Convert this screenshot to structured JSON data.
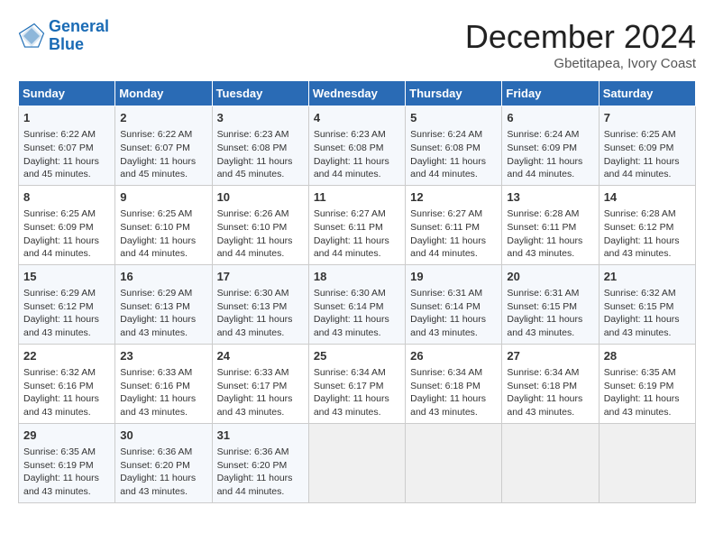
{
  "header": {
    "logo_line1": "General",
    "logo_line2": "Blue",
    "month": "December 2024",
    "location": "Gbetitapea, Ivory Coast"
  },
  "weekdays": [
    "Sunday",
    "Monday",
    "Tuesday",
    "Wednesday",
    "Thursday",
    "Friday",
    "Saturday"
  ],
  "weeks": [
    [
      {
        "day": "1",
        "lines": [
          "Sunrise: 6:22 AM",
          "Sunset: 6:07 PM",
          "Daylight: 11 hours",
          "and 45 minutes."
        ]
      },
      {
        "day": "2",
        "lines": [
          "Sunrise: 6:22 AM",
          "Sunset: 6:07 PM",
          "Daylight: 11 hours",
          "and 45 minutes."
        ]
      },
      {
        "day": "3",
        "lines": [
          "Sunrise: 6:23 AM",
          "Sunset: 6:08 PM",
          "Daylight: 11 hours",
          "and 45 minutes."
        ]
      },
      {
        "day": "4",
        "lines": [
          "Sunrise: 6:23 AM",
          "Sunset: 6:08 PM",
          "Daylight: 11 hours",
          "and 44 minutes."
        ]
      },
      {
        "day": "5",
        "lines": [
          "Sunrise: 6:24 AM",
          "Sunset: 6:08 PM",
          "Daylight: 11 hours",
          "and 44 minutes."
        ]
      },
      {
        "day": "6",
        "lines": [
          "Sunrise: 6:24 AM",
          "Sunset: 6:09 PM",
          "Daylight: 11 hours",
          "and 44 minutes."
        ]
      },
      {
        "day": "7",
        "lines": [
          "Sunrise: 6:25 AM",
          "Sunset: 6:09 PM",
          "Daylight: 11 hours",
          "and 44 minutes."
        ]
      }
    ],
    [
      {
        "day": "8",
        "lines": [
          "Sunrise: 6:25 AM",
          "Sunset: 6:09 PM",
          "Daylight: 11 hours",
          "and 44 minutes."
        ]
      },
      {
        "day": "9",
        "lines": [
          "Sunrise: 6:25 AM",
          "Sunset: 6:10 PM",
          "Daylight: 11 hours",
          "and 44 minutes."
        ]
      },
      {
        "day": "10",
        "lines": [
          "Sunrise: 6:26 AM",
          "Sunset: 6:10 PM",
          "Daylight: 11 hours",
          "and 44 minutes."
        ]
      },
      {
        "day": "11",
        "lines": [
          "Sunrise: 6:27 AM",
          "Sunset: 6:11 PM",
          "Daylight: 11 hours",
          "and 44 minutes."
        ]
      },
      {
        "day": "12",
        "lines": [
          "Sunrise: 6:27 AM",
          "Sunset: 6:11 PM",
          "Daylight: 11 hours",
          "and 44 minutes."
        ]
      },
      {
        "day": "13",
        "lines": [
          "Sunrise: 6:28 AM",
          "Sunset: 6:11 PM",
          "Daylight: 11 hours",
          "and 43 minutes."
        ]
      },
      {
        "day": "14",
        "lines": [
          "Sunrise: 6:28 AM",
          "Sunset: 6:12 PM",
          "Daylight: 11 hours",
          "and 43 minutes."
        ]
      }
    ],
    [
      {
        "day": "15",
        "lines": [
          "Sunrise: 6:29 AM",
          "Sunset: 6:12 PM",
          "Daylight: 11 hours",
          "and 43 minutes."
        ]
      },
      {
        "day": "16",
        "lines": [
          "Sunrise: 6:29 AM",
          "Sunset: 6:13 PM",
          "Daylight: 11 hours",
          "and 43 minutes."
        ]
      },
      {
        "day": "17",
        "lines": [
          "Sunrise: 6:30 AM",
          "Sunset: 6:13 PM",
          "Daylight: 11 hours",
          "and 43 minutes."
        ]
      },
      {
        "day": "18",
        "lines": [
          "Sunrise: 6:30 AM",
          "Sunset: 6:14 PM",
          "Daylight: 11 hours",
          "and 43 minutes."
        ]
      },
      {
        "day": "19",
        "lines": [
          "Sunrise: 6:31 AM",
          "Sunset: 6:14 PM",
          "Daylight: 11 hours",
          "and 43 minutes."
        ]
      },
      {
        "day": "20",
        "lines": [
          "Sunrise: 6:31 AM",
          "Sunset: 6:15 PM",
          "Daylight: 11 hours",
          "and 43 minutes."
        ]
      },
      {
        "day": "21",
        "lines": [
          "Sunrise: 6:32 AM",
          "Sunset: 6:15 PM",
          "Daylight: 11 hours",
          "and 43 minutes."
        ]
      }
    ],
    [
      {
        "day": "22",
        "lines": [
          "Sunrise: 6:32 AM",
          "Sunset: 6:16 PM",
          "Daylight: 11 hours",
          "and 43 minutes."
        ]
      },
      {
        "day": "23",
        "lines": [
          "Sunrise: 6:33 AM",
          "Sunset: 6:16 PM",
          "Daylight: 11 hours",
          "and 43 minutes."
        ]
      },
      {
        "day": "24",
        "lines": [
          "Sunrise: 6:33 AM",
          "Sunset: 6:17 PM",
          "Daylight: 11 hours",
          "and 43 minutes."
        ]
      },
      {
        "day": "25",
        "lines": [
          "Sunrise: 6:34 AM",
          "Sunset: 6:17 PM",
          "Daylight: 11 hours",
          "and 43 minutes."
        ]
      },
      {
        "day": "26",
        "lines": [
          "Sunrise: 6:34 AM",
          "Sunset: 6:18 PM",
          "Daylight: 11 hours",
          "and 43 minutes."
        ]
      },
      {
        "day": "27",
        "lines": [
          "Sunrise: 6:34 AM",
          "Sunset: 6:18 PM",
          "Daylight: 11 hours",
          "and 43 minutes."
        ]
      },
      {
        "day": "28",
        "lines": [
          "Sunrise: 6:35 AM",
          "Sunset: 6:19 PM",
          "Daylight: 11 hours",
          "and 43 minutes."
        ]
      }
    ],
    [
      {
        "day": "29",
        "lines": [
          "Sunrise: 6:35 AM",
          "Sunset: 6:19 PM",
          "Daylight: 11 hours",
          "and 43 minutes."
        ]
      },
      {
        "day": "30",
        "lines": [
          "Sunrise: 6:36 AM",
          "Sunset: 6:20 PM",
          "Daylight: 11 hours",
          "and 43 minutes."
        ]
      },
      {
        "day": "31",
        "lines": [
          "Sunrise: 6:36 AM",
          "Sunset: 6:20 PM",
          "Daylight: 11 hours",
          "and 44 minutes."
        ]
      },
      null,
      null,
      null,
      null
    ]
  ]
}
